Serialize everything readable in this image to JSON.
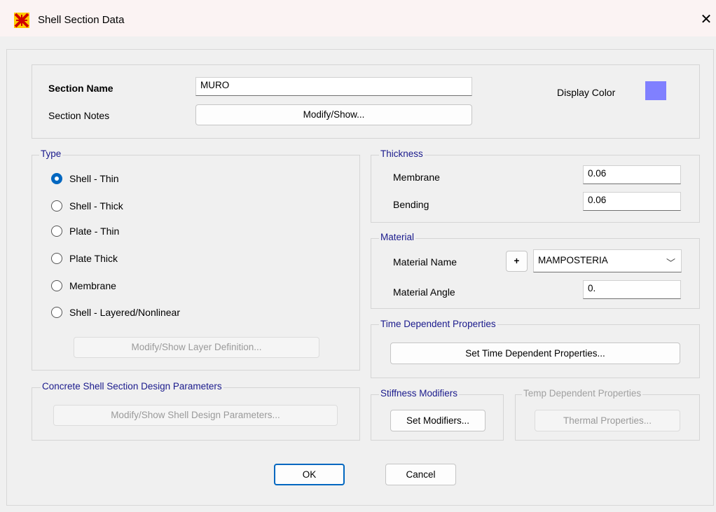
{
  "window": {
    "title": "Shell Section Data",
    "close_glyph": "✕",
    "icon": "app-logo-icon"
  },
  "header": {
    "section_name_label": "Section Name",
    "section_name_value": "MURO",
    "section_notes_label": "Section Notes",
    "modify_show_label": "Modify/Show...",
    "display_color_label": "Display Color",
    "display_color": "#8080ff"
  },
  "type": {
    "legend": "Type",
    "options": [
      {
        "label": "Shell - Thin",
        "checked": true
      },
      {
        "label": "Shell - Thick",
        "checked": false
      },
      {
        "label": "Plate - Thin",
        "checked": false
      },
      {
        "label": "Plate Thick",
        "checked": false
      },
      {
        "label": "Membrane",
        "checked": false
      },
      {
        "label": "Shell - Layered/Nonlinear",
        "checked": false
      }
    ],
    "layer_button": "Modify/Show Layer Definition..."
  },
  "concrete": {
    "legend": "Concrete Shell Section Design Parameters",
    "button": "Modify/Show Shell Design Parameters..."
  },
  "thickness": {
    "legend": "Thickness",
    "membrane_label": "Membrane",
    "membrane_value": "0.06",
    "bending_label": "Bending",
    "bending_value": "0.06"
  },
  "material": {
    "legend": "Material",
    "name_label": "Material Name",
    "add_button": "+",
    "name_value": "MAMPOSTERIA",
    "angle_label": "Material Angle",
    "angle_value": "0."
  },
  "time_dependent": {
    "legend": "Time Dependent Properties",
    "button": "Set Time Dependent Properties..."
  },
  "stiffness": {
    "legend": "Stiffness Modifiers",
    "button": "Set Modifiers..."
  },
  "temp_dependent": {
    "legend": "Temp Dependent Properties",
    "button": "Thermal Properties..."
  },
  "footer": {
    "ok": "OK",
    "cancel": "Cancel"
  }
}
